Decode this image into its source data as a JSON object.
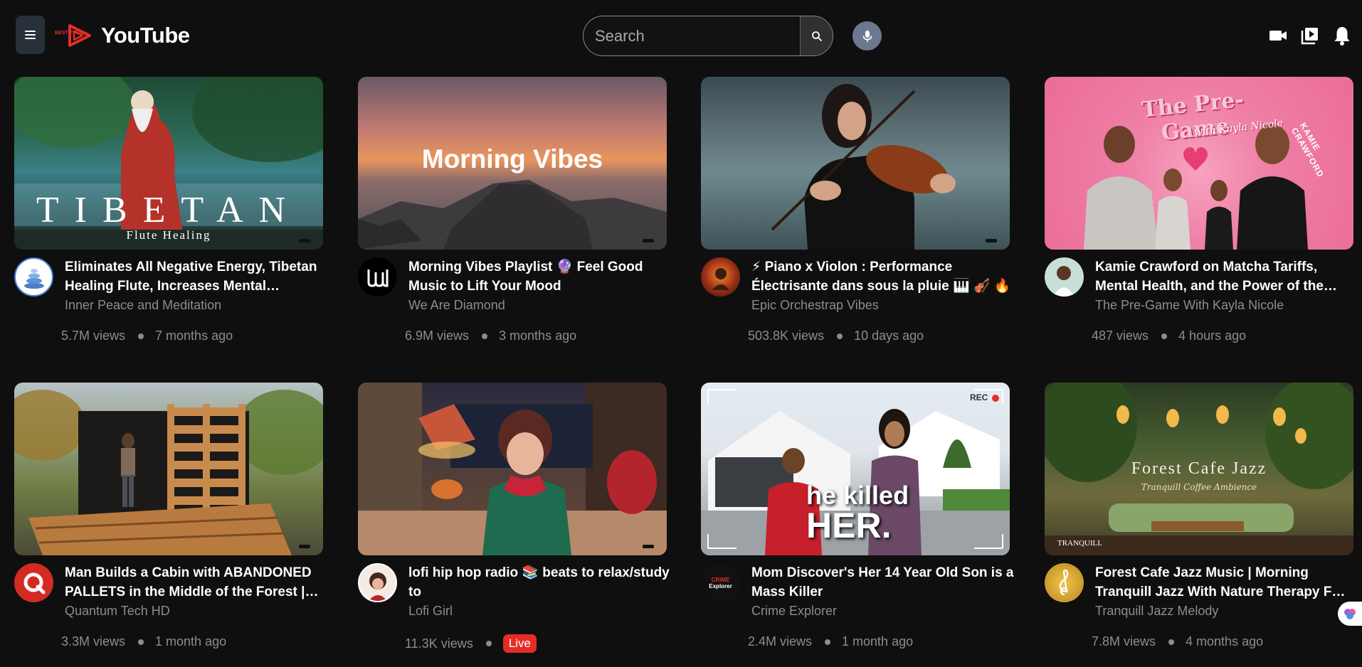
{
  "header": {
    "logo_badge": "BEST TUBE",
    "logo_text": "YouTube",
    "search_placeholder": "Search"
  },
  "icons": {
    "menu": "menu-icon",
    "search": "search-icon",
    "mic": "mic-icon",
    "create": "video-camera-icon",
    "library": "playlist-play-icon",
    "notifications": "bell-icon"
  },
  "videos": [
    {
      "title": "Eliminates All Negative Energy, Tibetan Healing Flute, Increases Mental…",
      "channel": "Inner Peace and Meditation",
      "views": "5.7M views",
      "age": "7 months ago",
      "thumb_text": "TIBETAN",
      "thumb_subtext": "Flute Healing"
    },
    {
      "title": "Morning Vibes Playlist 🔮 Feel Good Music to Lift Your Mood",
      "channel": "We Are Diamond",
      "views": "6.9M views",
      "age": "3 months ago",
      "thumb_text": "Morning Vibes"
    },
    {
      "title": "⚡ Piano x Violon : Performance Électrisante dans sous la pluie 🎹 🎻 🔥",
      "channel": "Epic Orchestrap Vibes",
      "views": "503.8K views",
      "age": "10 days ago"
    },
    {
      "title": "Kamie Crawford on Matcha Tariffs, Mental Health, and the Power of the…",
      "channel": "The Pre-Game With Kayla Nicole",
      "views": "487 views",
      "age": "4 hours ago",
      "thumb_text": "The Pre-Game",
      "thumb_subtext": "with Kayla Nicole",
      "thumb_side": "KAMIE CRAWFORD"
    },
    {
      "title": "Man Builds a Cabin with ABANDONED PALLETS in the Middle of the Forest |…",
      "channel": "Quantum Tech HD",
      "views": "3.3M views",
      "age": "1 month ago"
    },
    {
      "title": "lofi hip hop radio 📚 beats to relax/study to",
      "channel": "Lofi Girl",
      "views": "11.3K views",
      "age": "",
      "live": "Live"
    },
    {
      "title": "Mom Discover's Her 14 Year Old Son is a Mass Killer",
      "channel": "Crime Explorer",
      "views": "2.4M views",
      "age": "1 month ago",
      "thumb_text": "he killed",
      "thumb_text2": "HER.",
      "thumb_rec": "REC",
      "avatar_text": "CRIME",
      "avatar_text2": "Explorer"
    },
    {
      "title": "Forest Cafe Jazz Music | Morning Tranquill Jazz With Nature Therapy F…",
      "channel": "Tranquill Jazz Melody",
      "views": "7.8M views",
      "age": "4 months ago",
      "thumb_text": "Forest Cafe Jazz",
      "thumb_subtext": "Tranquill Coffee Ambience",
      "thumb_logo": "TRANQUILL"
    }
  ]
}
